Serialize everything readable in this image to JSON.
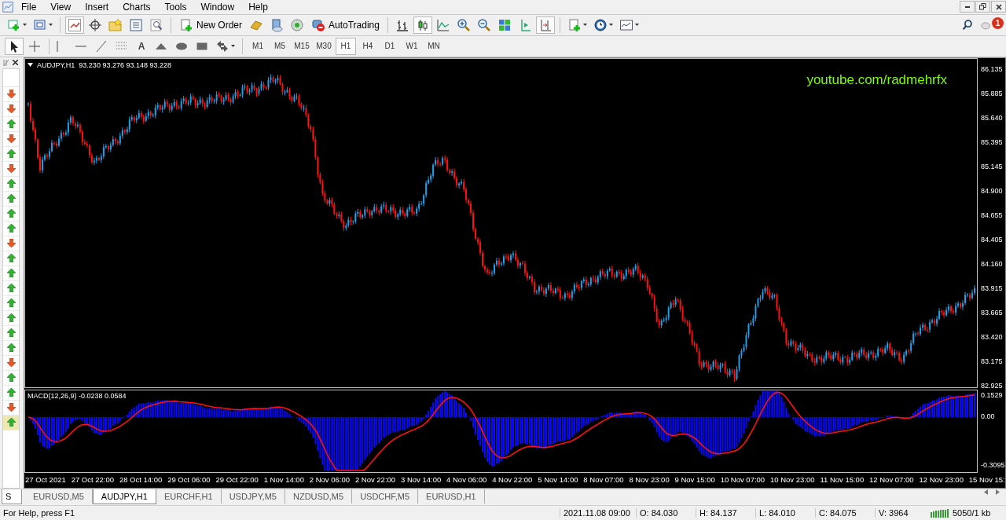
{
  "menu": [
    "File",
    "View",
    "Insert",
    "Charts",
    "Tools",
    "Window",
    "Help"
  ],
  "toolbar": {
    "new_order": "New Order",
    "auto_trading": "AutoTrading",
    "text_tool": "A"
  },
  "notifications": {
    "badge": "1"
  },
  "timeframes": [
    {
      "label": "M1",
      "selected": false
    },
    {
      "label": "M5",
      "selected": false
    },
    {
      "label": "M15",
      "selected": false
    },
    {
      "label": "M30",
      "selected": false
    },
    {
      "label": "H1",
      "selected": true
    },
    {
      "label": "H4",
      "selected": false
    },
    {
      "label": "D1",
      "selected": false
    },
    {
      "label": "W1",
      "selected": false
    },
    {
      "label": "MN",
      "selected": false
    }
  ],
  "signals": [
    {
      "kind": "down",
      "selected": false
    },
    {
      "kind": "down",
      "selected": false
    },
    {
      "kind": "up",
      "selected": false
    },
    {
      "kind": "down",
      "selected": false
    },
    {
      "kind": "up",
      "selected": false
    },
    {
      "kind": "down",
      "selected": false
    },
    {
      "kind": "up",
      "selected": false
    },
    {
      "kind": "up",
      "selected": false
    },
    {
      "kind": "up",
      "selected": false
    },
    {
      "kind": "up",
      "selected": false
    },
    {
      "kind": "down",
      "selected": false
    },
    {
      "kind": "up",
      "selected": false
    },
    {
      "kind": "up",
      "selected": false
    },
    {
      "kind": "up",
      "selected": false
    },
    {
      "kind": "up",
      "selected": false
    },
    {
      "kind": "up",
      "selected": false
    },
    {
      "kind": "up",
      "selected": false
    },
    {
      "kind": "up",
      "selected": false
    },
    {
      "kind": "down",
      "selected": false
    },
    {
      "kind": "up",
      "selected": false
    },
    {
      "kind": "up",
      "selected": false
    },
    {
      "kind": "down",
      "selected": false
    },
    {
      "kind": "up",
      "selected": true
    }
  ],
  "navigator_tab": "S",
  "chart": {
    "header": "AUDJPY,H1  93.230 93.276 93.148 93.228",
    "overlay_text": "youtube.com/radmehrfx",
    "price_labels": [
      "86.135",
      "85.885",
      "85.640",
      "85.395",
      "85.145",
      "84.900",
      "84.655",
      "84.405",
      "84.160",
      "83.915",
      "83.665",
      "83.420",
      "83.175",
      "82.925"
    ],
    "indicator": {
      "title": "MACD(12,26,9) -0.0238 0.0584",
      "labels": [
        "0.1529",
        "0.00",
        "-0.3095"
      ]
    },
    "time_labels": [
      "27 Oct 2021",
      "27 Oct 22:00",
      "28 Oct 14:00",
      "29 Oct 06:00",
      "29 Oct 22:00",
      "1 Nov 14:00",
      "2 Nov 06:00",
      "2 Nov 22:00",
      "3 Nov 14:00",
      "4 Nov 06:00",
      "4 Nov 22:00",
      "5 Nov 14:00",
      "8 Nov 07:00",
      "8 Nov 23:00",
      "9 Nov 15:00",
      "10 Nov 07:00",
      "10 Nov 23:00",
      "11 Nov 15:00",
      "12 Nov 07:00",
      "12 Nov 23:00",
      "15 Nov 15:"
    ]
  },
  "chart_tabs": [
    {
      "label": "EURUSD,M5",
      "selected": false
    },
    {
      "label": "AUDJPY,H1",
      "selected": true
    },
    {
      "label": "EURCHF,H1",
      "selected": false
    },
    {
      "label": "USDJPY,M5",
      "selected": false
    },
    {
      "label": "NZDUSD,M5",
      "selected": false
    },
    {
      "label": "USDCHF,M5",
      "selected": false
    },
    {
      "label": "EURUSD,H1",
      "selected": false
    }
  ],
  "status_bar": {
    "help": "For Help, press F1",
    "time": "2021.11.08 09:00",
    "open": "O: 84.030",
    "high": "H: 84.137",
    "low": "L: 84.010",
    "close": "C: 84.075",
    "volume": "V: 3964",
    "traffic": "5050/1 kb"
  }
}
